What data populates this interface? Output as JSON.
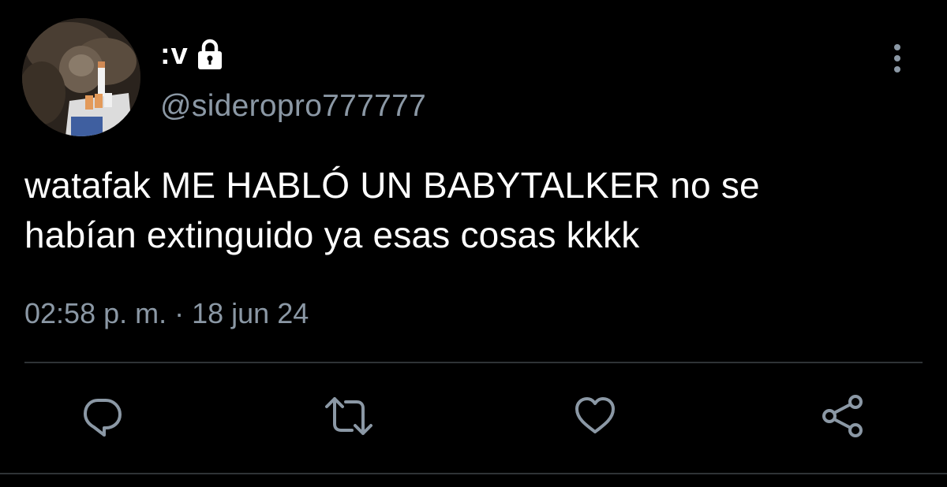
{
  "tweet": {
    "display_name": ":v",
    "handle": "@sideropro777777",
    "text_line1": "watafak ME HABLÓ UN BABYTALKER no se",
    "text_line2": "habían extinguido ya esas cosas kkkk",
    "time": "02:58 p. m.",
    "separator": " · ",
    "date": "18 jun 24",
    "protected_account": true
  },
  "icons": {
    "lock": "lock-icon",
    "more": "more-vertical-icon",
    "reply": "reply-icon",
    "retweet": "retweet-icon",
    "like": "heart-icon",
    "share": "share-icon"
  },
  "colors": {
    "background": "#000000",
    "text": "#ffffff",
    "secondary": "#8b98a5",
    "divider": "#2f3336"
  }
}
